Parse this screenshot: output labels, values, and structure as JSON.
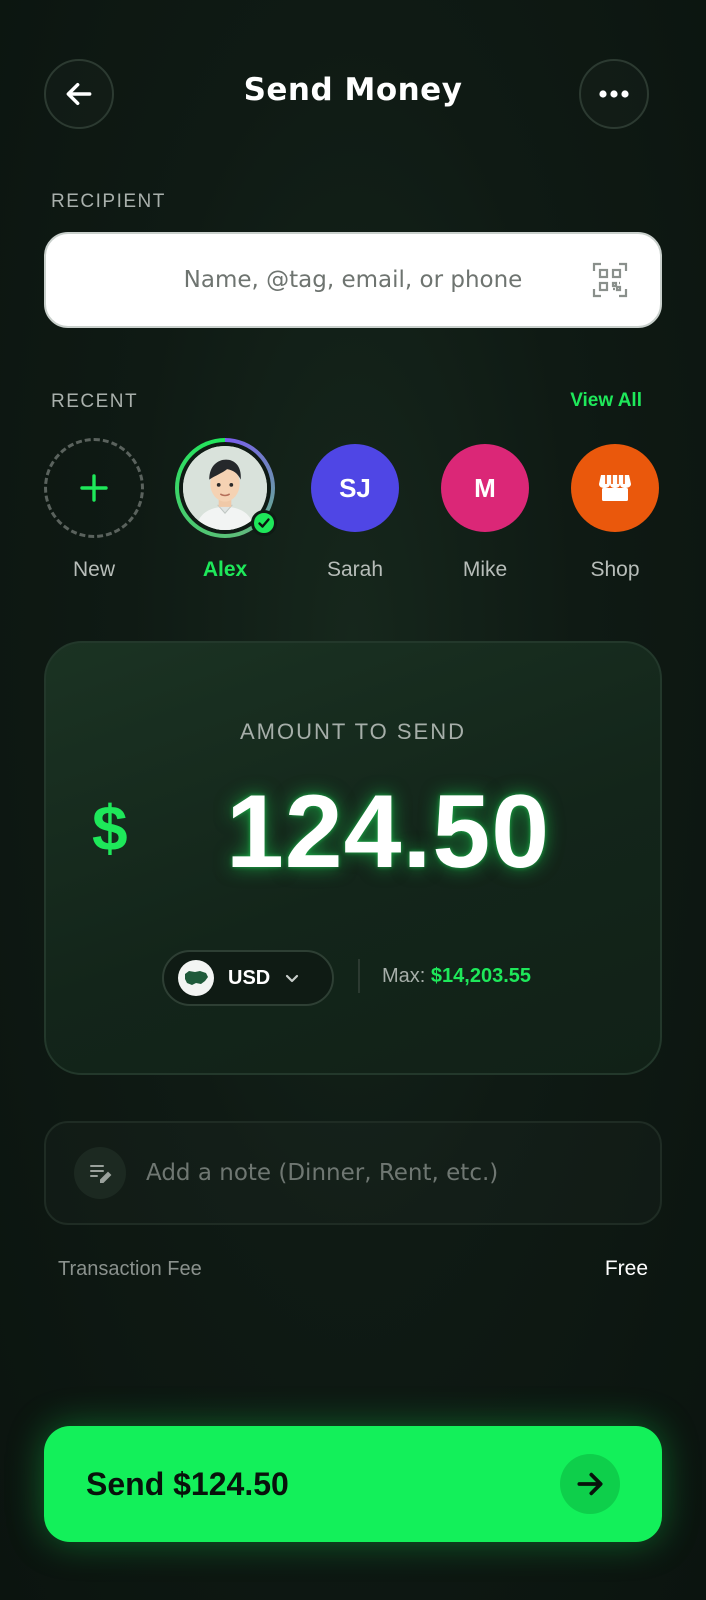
{
  "header": {
    "title": "Send Money",
    "back_icon": "arrow-left-icon",
    "more_icon": "more-horizontal-icon"
  },
  "recipient": {
    "label": "RECIPIENT",
    "placeholder": "Name, @tag, email, or phone",
    "value": "",
    "scan_icon": "qr-scan-icon"
  },
  "recent": {
    "label": "RECENT",
    "view_all": "View All",
    "contacts": [
      {
        "name": "New",
        "type": "add"
      },
      {
        "name": "Alex",
        "type": "photo",
        "selected": true,
        "verified": true
      },
      {
        "name": "Sarah",
        "initials": "SJ",
        "color": "#4f46e5"
      },
      {
        "name": "Mike",
        "initials": "M",
        "color": "#db2777"
      },
      {
        "name": "Shop",
        "icon": "storefront-icon",
        "color": "#ea580c"
      }
    ]
  },
  "amount": {
    "label": "AMOUNT TO SEND",
    "currency_symbol": "$",
    "value": "124.50",
    "currency_code": "USD",
    "max_label": "Max:",
    "max_value": "$14,203.55"
  },
  "note": {
    "placeholder": "Add a note (Dinner, Rent, etc.)",
    "icon": "note-edit-icon"
  },
  "fee": {
    "label": "Transaction Fee",
    "value": "Free"
  },
  "send_button": {
    "label": "Send $124.50",
    "icon": "arrow-right-icon"
  },
  "colors": {
    "accent": "#13f05a",
    "background": "#0f1a14"
  }
}
